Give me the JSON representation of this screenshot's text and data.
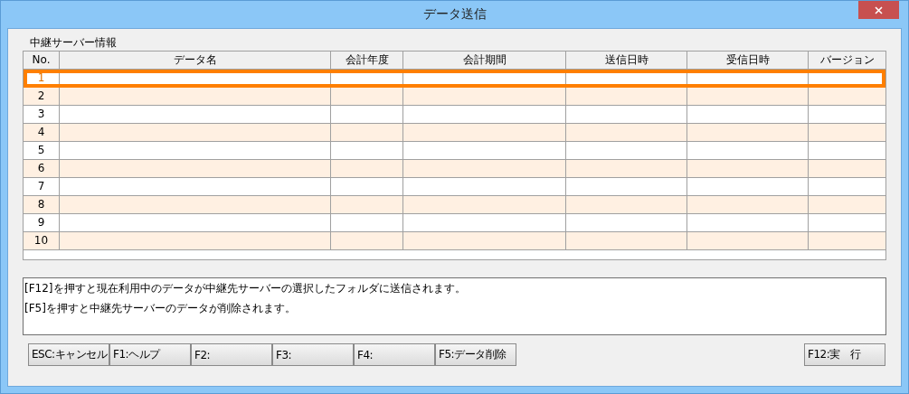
{
  "window": {
    "title": "データ送信"
  },
  "section_label": "中継サーバー情報",
  "table": {
    "columns": [
      "No.",
      "データ名",
      "会計年度",
      "会計期間",
      "送信日時",
      "受信日時",
      "バージョン"
    ],
    "rows": [
      {
        "no": "1",
        "selected": true
      },
      {
        "no": "2",
        "selected": false
      },
      {
        "no": "3",
        "selected": false
      },
      {
        "no": "4",
        "selected": false
      },
      {
        "no": "5",
        "selected": false
      },
      {
        "no": "6",
        "selected": false
      },
      {
        "no": "7",
        "selected": false
      },
      {
        "no": "8",
        "selected": false
      },
      {
        "no": "9",
        "selected": false
      },
      {
        "no": "10",
        "selected": false
      }
    ]
  },
  "messages": [
    "[F12]を押すと現在利用中のデータが中継先サーバーの選択したフォルダに送信されます。",
    "[F5]を押すと中継先サーバーのデータが削除されます。"
  ],
  "function_keys": [
    "ESC:キャンセル",
    "F1:ヘルプ",
    "F2:",
    "F3:",
    "F4:",
    "F5:データ削除"
  ],
  "execute_button": "F12:実　行"
}
